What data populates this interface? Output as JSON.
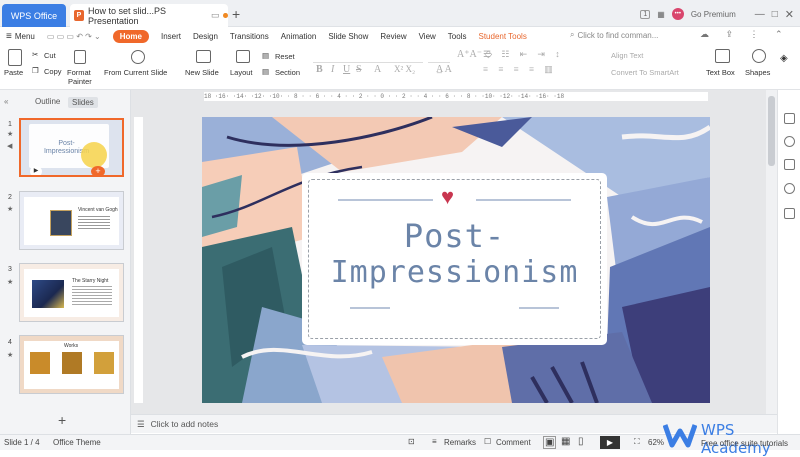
{
  "tabs": {
    "wps": "WPS Office",
    "doc": "How to set slid...PS Presentation",
    "new_tab": "+"
  },
  "titlebar_right": {
    "badge": "1",
    "avatar": "•••",
    "premium": "Go Premium"
  },
  "menu": {
    "menu_label": "Menu",
    "items": [
      "Home",
      "Insert",
      "Design",
      "Transitions",
      "Animation",
      "Slide Show",
      "Review",
      "View",
      "Tools",
      "Student Tools"
    ],
    "search_placeholder": "Click to find comman..."
  },
  "ribbon": {
    "paste": "Paste",
    "cut": "Cut",
    "copy": "Copy",
    "format_painter_1": "Format",
    "format_painter_2": "Painter",
    "from_current_slide": "From Current Slide",
    "new_slide": "New Slide",
    "layout": "Layout",
    "reset": "Reset",
    "section": "Section",
    "align_text": "Align Text",
    "convert_smartart": "Convert To SmartArt",
    "text_box": "Text Box",
    "shapes": "Shapes"
  },
  "panel": {
    "outline_tab": "Outline",
    "slides_tab": "Slides",
    "add": "+"
  },
  "thumbnails": [
    {
      "num": "1",
      "text": "Post-Impressionism"
    },
    {
      "num": "2",
      "text": "Vincent van Gogh"
    },
    {
      "num": "3",
      "text": "The Starry Night"
    },
    {
      "num": "4",
      "text": "Works"
    }
  ],
  "ruler_text": "18 ·16· ·14· ·12· ·10· · 8 · · 6 · · 4 · · 2 · · 0 · · 2 · · 4 · · 6 · · 8 · ·10· ·12· ·14· ·16· ·18",
  "slide": {
    "title_line1": "Post-",
    "title_line2": "Impressionism"
  },
  "notes_placeholder": "Click to add notes",
  "status": {
    "slide_counter": "Slide 1 / 4",
    "theme": "Office Theme",
    "remarks": "Remarks",
    "comment": "Comment",
    "zoom": "62%"
  },
  "watermark": {
    "brand": "WPS Academy",
    "tagline": "Free office suite tutorials"
  },
  "colors": {
    "accent": "#f0682a",
    "tab_blue": "#3b7ee4",
    "title_blue": "#6b84a8",
    "heart": "#c8364f"
  }
}
